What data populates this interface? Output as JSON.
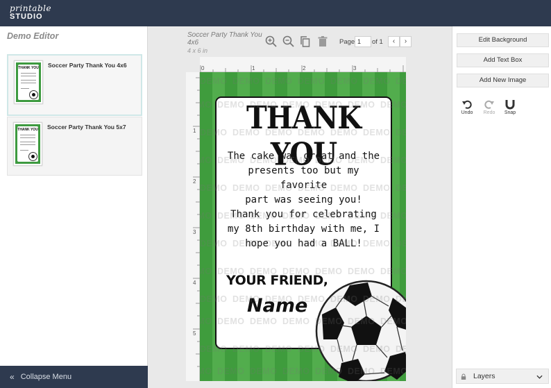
{
  "logo": {
    "line1": "printable",
    "line2": "STUDIO"
  },
  "sidebar": {
    "title": "Demo Editor",
    "templates": [
      {
        "name": "Soccer Party Thank You 4x6",
        "thumb_title": "THANK YOU"
      },
      {
        "name": "Soccer Party Thank You 5x7",
        "thumb_title": "THANK YOU"
      }
    ],
    "collapse_label": "Collapse Menu"
  },
  "document": {
    "title": "Soccer Party Thank You 4x6",
    "size": "4 x 6 in"
  },
  "pager": {
    "label": "Page",
    "current": "1",
    "of": "of 1"
  },
  "ruler": {
    "h": [
      "0",
      "1",
      "2",
      "3"
    ],
    "v": [
      "1",
      "2",
      "3",
      "4",
      "5"
    ]
  },
  "card": {
    "heading": "THANK YOU",
    "message1": [
      "The cake was great and the",
      "presents too but my favorite",
      "part was seeing you!"
    ],
    "message2": [
      "Thank you for celebrating",
      "my 8th birthday with me, I",
      "hope you had a BALL!"
    ],
    "signoff": "YOUR FRIEND,",
    "name": "Name",
    "watermark": "DEMO"
  },
  "right_panel": {
    "edit_background": "Edit Background",
    "add_text_box": "Add Text Box",
    "add_new_image": "Add New Image",
    "undo": "Undo",
    "redo": "Redo",
    "snap": "Snap",
    "layers": "Layers"
  },
  "colors": {
    "topbar": "#2e3a4f",
    "grass_dark": "#3f9c3d",
    "grass_light": "#52ad4d"
  }
}
